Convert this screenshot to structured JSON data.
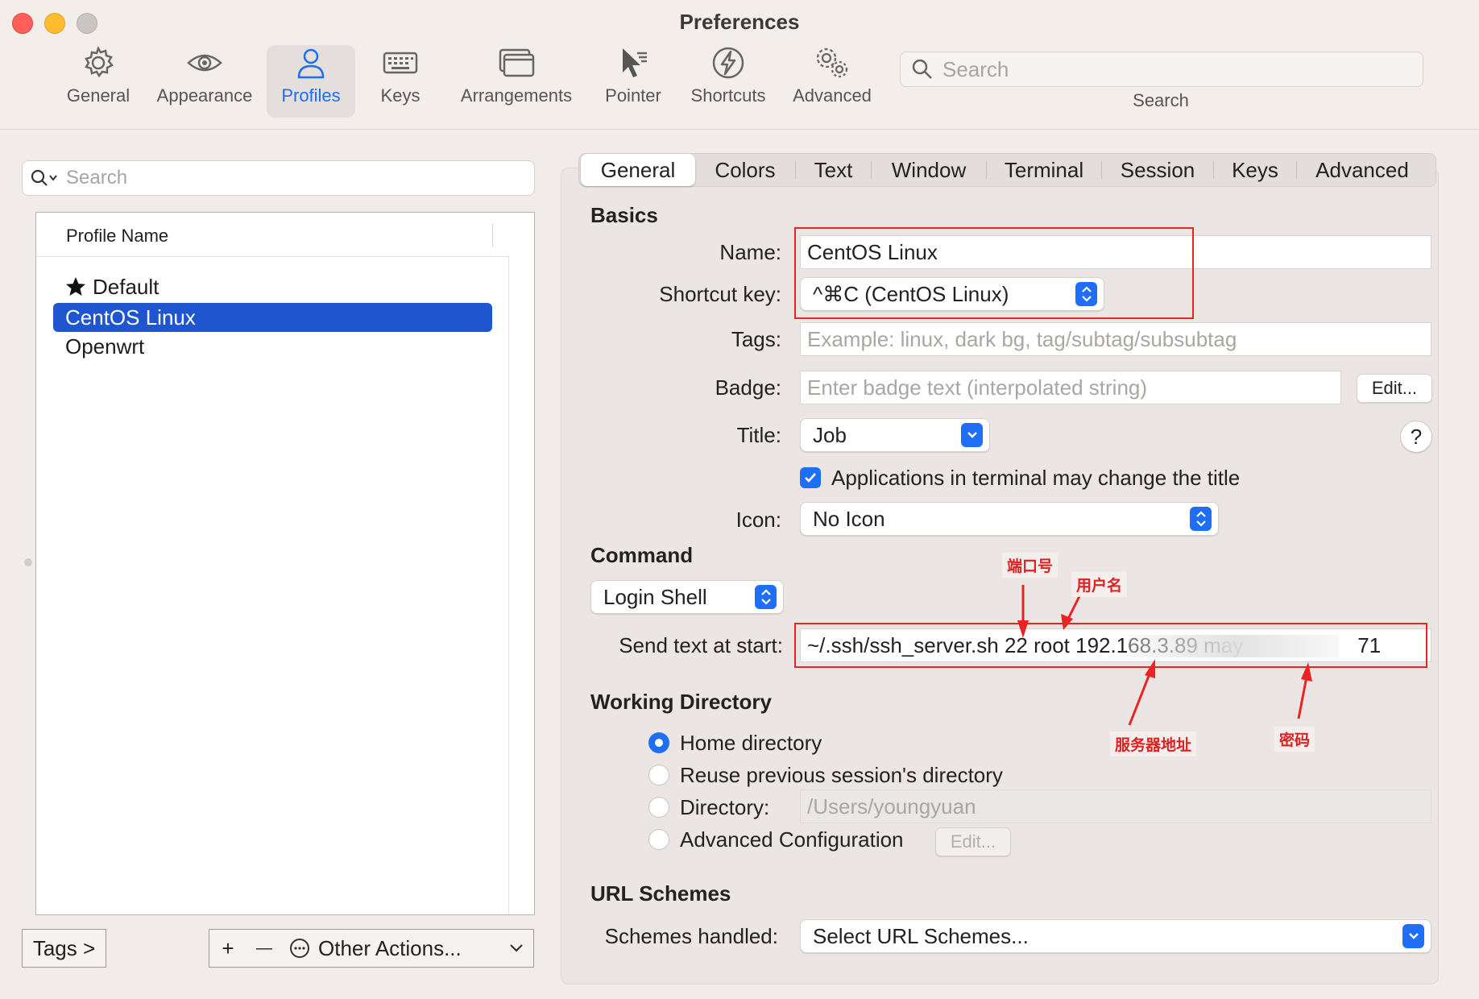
{
  "window": {
    "title": "Preferences",
    "traffic_colors": {
      "close": "#ff5f57",
      "minimize": "#febc2e",
      "zoom": "#c9c5c3"
    }
  },
  "toolbar": {
    "items": [
      {
        "label": "General",
        "icon": "gear-icon"
      },
      {
        "label": "Appearance",
        "icon": "eye-icon"
      },
      {
        "label": "Profiles",
        "icon": "person-icon",
        "selected": true
      },
      {
        "label": "Keys",
        "icon": "keyboard-icon"
      },
      {
        "label": "Arrangements",
        "icon": "windows-icon"
      },
      {
        "label": "Pointer",
        "icon": "pointer-icon"
      },
      {
        "label": "Shortcuts",
        "icon": "bolt-icon"
      },
      {
        "label": "Advanced",
        "icon": "gears-icon"
      }
    ],
    "search": {
      "placeholder": "Search",
      "label": "Search"
    }
  },
  "left": {
    "search_placeholder": "Search",
    "column_header": "Profile Name",
    "profiles": [
      {
        "name": "Default",
        "starred": true
      },
      {
        "name": "CentOS Linux",
        "selected": true
      },
      {
        "name": "Openwrt"
      }
    ],
    "tags_button": "Tags >",
    "add_button": "+",
    "remove_button": "—",
    "other_actions": "Other Actions..."
  },
  "tabs": [
    "General",
    "Colors",
    "Text",
    "Window",
    "Terminal",
    "Session",
    "Keys",
    "Advanced"
  ],
  "selected_tab": "General",
  "basics": {
    "section": "Basics",
    "name_label": "Name:",
    "name_value": "CentOS Linux",
    "shortcut_label": "Shortcut key:",
    "shortcut_value": "^⌘C (CentOS Linux)",
    "tags_label": "Tags:",
    "tags_placeholder": "Example: linux, dark bg, tag/subtag/subsubtag",
    "badge_label": "Badge:",
    "badge_placeholder": "Enter badge text (interpolated string)",
    "badge_edit": "Edit...",
    "title_label": "Title:",
    "title_value": "Job",
    "help": "?",
    "apps_change_title": "Applications in terminal may change the title",
    "icon_label": "Icon:",
    "icon_value": "No Icon"
  },
  "command": {
    "section": "Command",
    "mode": "Login Shell",
    "send_label": "Send text at start:",
    "send_value": "~/.ssh/ssh_server.sh 22 root 192.168.3.89 may",
    "send_value_tail": "71"
  },
  "working_dir": {
    "section": "Working Directory",
    "options": [
      "Home directory",
      "Reuse previous session's directory",
      "Directory:",
      "Advanced Configuration"
    ],
    "selected": "Home directory",
    "directory_value": "/Users/youngyuan",
    "advanced_edit": "Edit..."
  },
  "url_schemes": {
    "section": "URL Schemes",
    "label": "Schemes handled:",
    "value": "Select URL Schemes..."
  },
  "annotations": {
    "port": "端口号",
    "user": "用户名",
    "server": "服务器地址",
    "password": "密码",
    "color": "#ea2424"
  },
  "accent": "#1e6ff5"
}
